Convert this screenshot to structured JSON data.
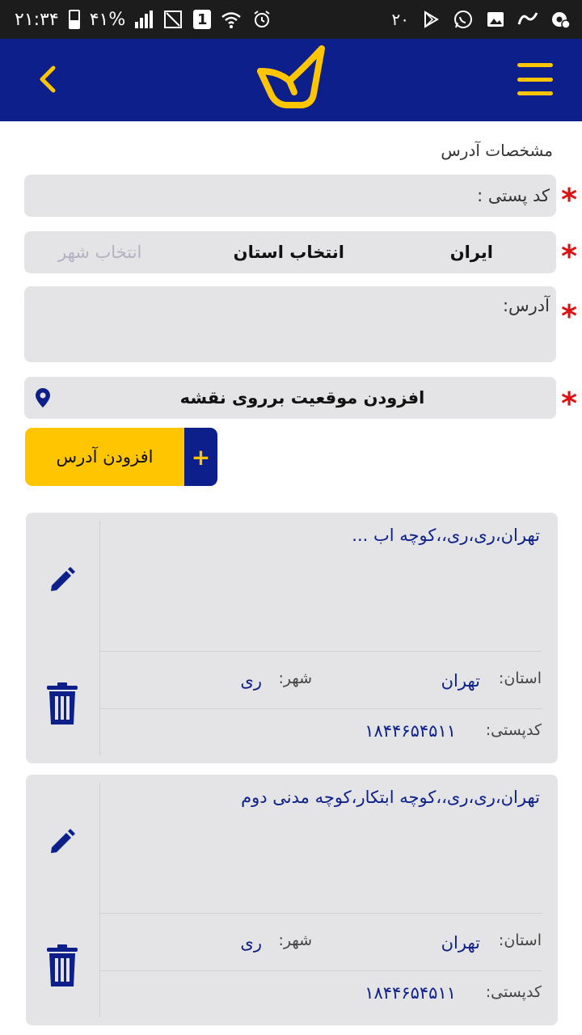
{
  "status_bar": {
    "time": "۲۱:۳۴",
    "battery": "۴۱%",
    "sim_badge": "1",
    "notification_count": "۲۰",
    "icons": [
      "battery-icon",
      "signal-icon",
      "no-signal-sim-icon",
      "wifi-icon",
      "alarm-icon",
      "play-store-icon",
      "whatsapp-icon",
      "gallery-icon",
      "app-icon",
      "settings-notification-icon"
    ]
  },
  "app_bar": {
    "back_icon": "chevron-left-icon",
    "logo_icon": "post-logo-icon",
    "menu_icon": "hamburger-menu-icon"
  },
  "form": {
    "section_title": "مشخصات آدرس",
    "postal_code_label": "کد پستی :",
    "country_value": "ایران",
    "province_placeholder": "انتخاب استان",
    "city_placeholder": "انتخاب شهر",
    "address_label": "آدرس:",
    "map_button_label": "افزودن موقعیت برروی نقشه",
    "required_mark": "*",
    "add_address_button": "افزودن آدرس",
    "add_plus": "+"
  },
  "addresses": [
    {
      "address": "تهران،ری،ری،،کوچه اب ...",
      "province_label": "استان:",
      "province": "تهران",
      "city_label": "شهر:",
      "city": "ری",
      "postal_label": "کدپستی:",
      "postal_code": "۱۸۴۴۶۵۴۵۱۱"
    },
    {
      "address": "تهران،ری،ری،،کوچه ابتکار،کوچه مدنی دوم",
      "province_label": "استان:",
      "province": "تهران",
      "city_label": "شهر:",
      "city": "ری",
      "postal_label": "کدپستی:",
      "postal_code": "۱۸۴۴۶۵۴۵۱۱"
    }
  ],
  "colors": {
    "primary": "#0d1f8a",
    "accent": "#ffc600",
    "required": "#e01010",
    "field_bg": "#e4e4e6"
  }
}
